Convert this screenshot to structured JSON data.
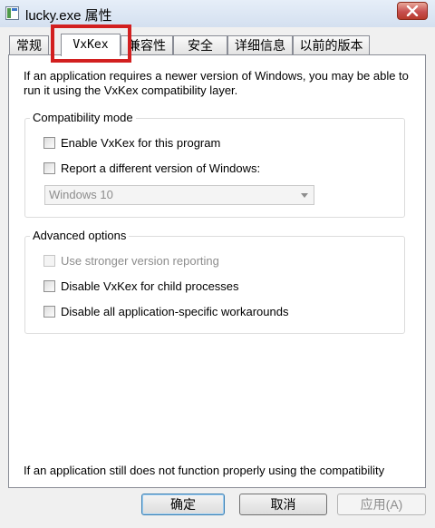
{
  "window": {
    "title": "lucky.exe 属性"
  },
  "tabs": [
    {
      "label": "常规"
    },
    {
      "label": "VxKex"
    },
    {
      "label": "兼容性"
    },
    {
      "label": "安全"
    },
    {
      "label": "详细信息"
    },
    {
      "label": "以前的版本"
    }
  ],
  "active_tab": "VxKex",
  "panel": {
    "intro_text": "If an application requires a newer version of Windows, you may be able to run it using the VxKex compatibility layer.",
    "compatibility_mode": {
      "title": "Compatibility mode",
      "enable_label": "Enable VxKex for this program",
      "enable_checked": false,
      "report_label": "Report a different version of Windows:",
      "report_checked": false,
      "version_select_value": "Windows 10"
    },
    "advanced_options": {
      "title": "Advanced options",
      "stronger_label": "Use stronger version reporting",
      "stronger_checked": false,
      "stronger_enabled": false,
      "child_label": "Disable VxKex for child processes",
      "child_checked": false,
      "workarounds_label": "Disable all application-specific workarounds",
      "workarounds_checked": false
    },
    "footer_text": "If an application still does not function properly using the compatibility"
  },
  "buttons": {
    "ok": "确定",
    "cancel": "取消",
    "apply": "应用(A)"
  },
  "colors": {
    "highlight": "#d21f1f",
    "close_button": "#c75050"
  },
  "icons": {
    "window_icon": "app-window-icon",
    "close": "close-icon",
    "dropdown": "chevron-down-icon"
  }
}
